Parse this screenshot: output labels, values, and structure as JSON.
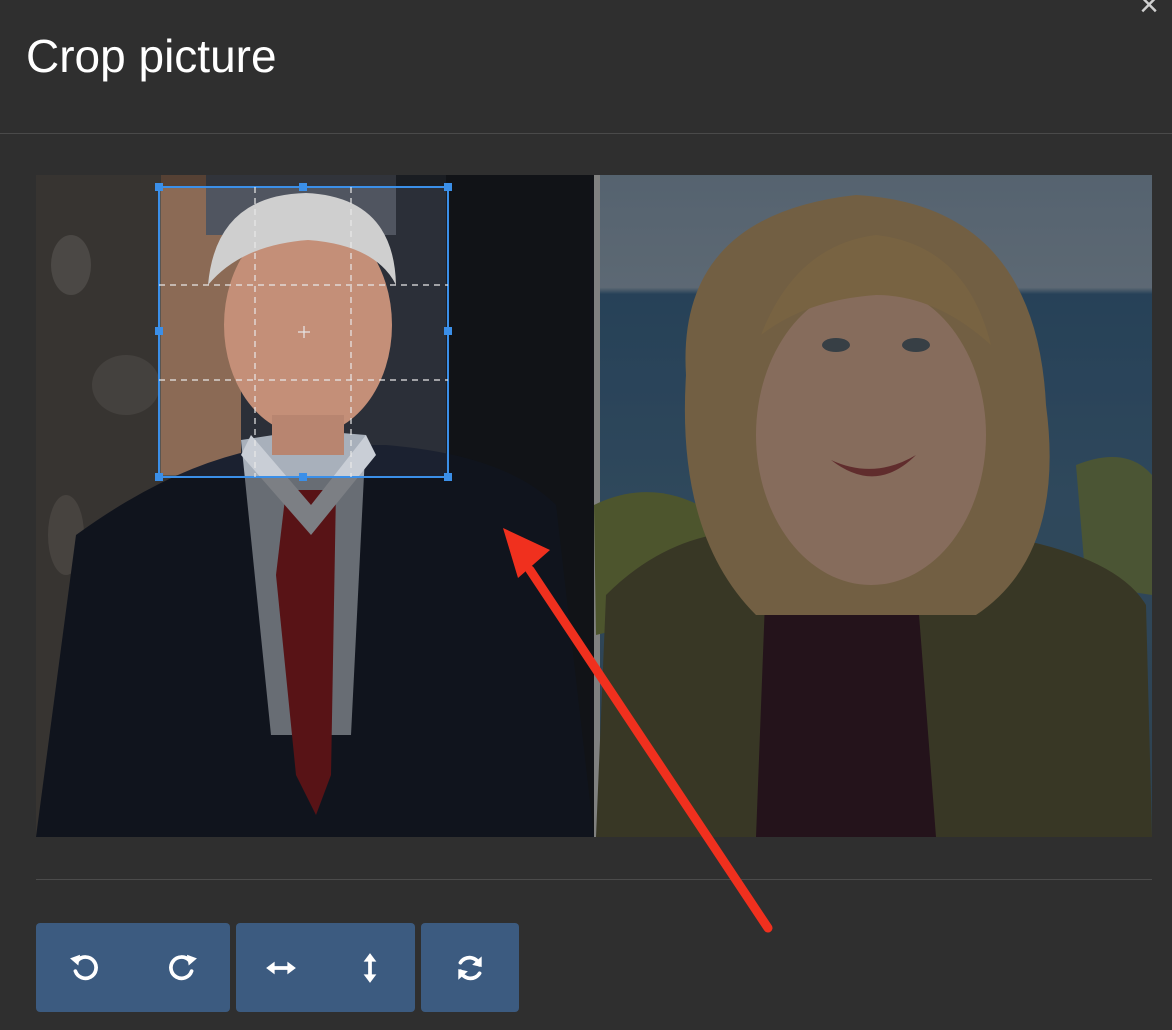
{
  "dialog": {
    "title": "Crop picture",
    "close_glyph": "×"
  },
  "toolbar": {
    "groups": [
      {
        "name": "rotate",
        "buttons": [
          {
            "icon": "rotate-left-icon"
          },
          {
            "icon": "rotate-right-icon"
          }
        ]
      },
      {
        "name": "flip",
        "buttons": [
          {
            "icon": "flip-horizontal-icon"
          },
          {
            "icon": "flip-vertical-icon"
          }
        ]
      },
      {
        "name": "reset",
        "buttons": [
          {
            "icon": "reset-icon"
          }
        ]
      }
    ]
  },
  "colors": {
    "background": "#2f2f2f",
    "button": "#3c5b80",
    "crop_box": "#3b8fe8",
    "annotation_arrow": "#f0301e"
  }
}
